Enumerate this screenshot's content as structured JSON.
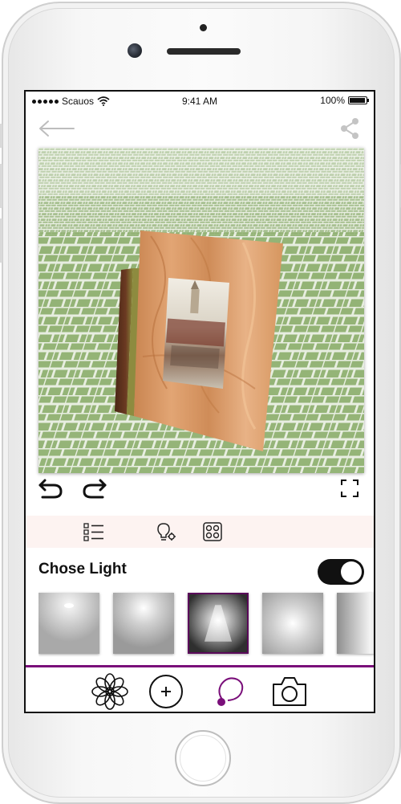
{
  "status_bar": {
    "carrier": "Scauos",
    "time": "9:41 AM",
    "battery": "100%"
  },
  "icons": {
    "back": "arrow-left-icon",
    "share": "share-icon",
    "undo": "undo-icon",
    "redo": "redo-icon",
    "fullscreen": "fullscreen-icon",
    "list": "list-checkbox-icon",
    "light_settings": "bulb-gear-icon",
    "grid": "grid-circles-icon",
    "tab_flower": "flower-icon",
    "tab_add": "plus-circle-icon",
    "tab_lasso": "lasso-icon",
    "tab_camera": "camera-icon"
  },
  "light_section": {
    "title": "Chose Light",
    "toggle_on": true,
    "thumbnails": [
      "light-1",
      "light-2",
      "light-3",
      "light-4",
      "light-5"
    ],
    "selected_index": 2
  },
  "colors": {
    "accent": "#7a0f7a",
    "toolbar_bg": "#fdf3f1",
    "toggle_bg": "#111111"
  }
}
